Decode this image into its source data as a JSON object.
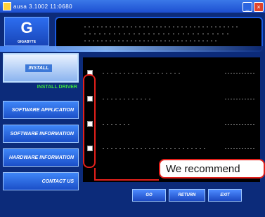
{
  "window": {
    "title": "ausa 3.1002 11:0680"
  },
  "logo": {
    "letter": "G",
    "brand": "GIGABYTE"
  },
  "sidebar": {
    "items": [
      {
        "label": "INSTALL"
      },
      {
        "label": "SOFTWARE APPLICATION"
      },
      {
        "label": "SOFTWARE INFORMATION"
      },
      {
        "label": "HARDWARE INFORMATION"
      },
      {
        "label": "CONTACT US"
      }
    ],
    "status_label": "INSTALL DRIVER"
  },
  "callout": {
    "text": "We recommend"
  },
  "bottom": {
    "go": "GO",
    "return": "RETURN",
    "exit": "EXIT"
  },
  "colors": {
    "highlight": "#e3201b",
    "panel": "#0c2b7a",
    "status": "#39e43d"
  }
}
